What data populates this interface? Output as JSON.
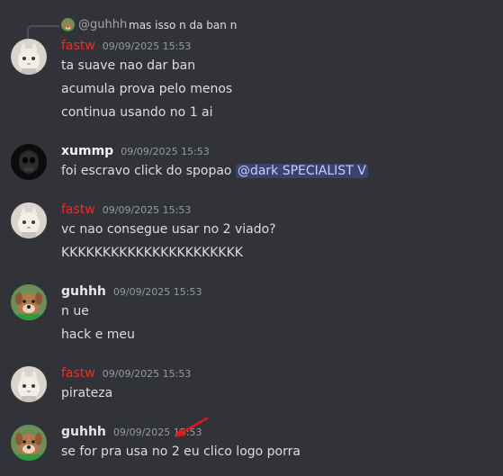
{
  "reply": {
    "user": "@guhhh",
    "text": "mas isso n da ban n"
  },
  "messages": [
    {
      "user": "fastw",
      "time": "09/09/2025 15:53",
      "lines": [
        "ta suave nao dar ban",
        "acumula prova pelo menos",
        "continua usando no 1 ai"
      ]
    },
    {
      "user": "xummp",
      "time": "09/09/2025 15:53",
      "text_before_mention": "foi escravo click do spopao ",
      "mention": "@dark SPECIALIST V"
    },
    {
      "user": "fastw",
      "time": "09/09/2025 15:53",
      "lines": [
        "vc nao consegue usar no 2 viado?",
        "KKKKKKKKKKKKKKKKKKKKKK"
      ]
    },
    {
      "user": "guhhh",
      "time": "09/09/2025 15:53",
      "lines": [
        "n ue",
        "hack e meu"
      ]
    },
    {
      "user": "fastw",
      "time": "09/09/2025 15:53",
      "lines": [
        "pirateza"
      ]
    },
    {
      "user": "guhhh",
      "time": "09/09/2025 15:53",
      "lines": [
        "se for pra usa no 2 eu clico logo porra"
      ]
    }
  ],
  "icons": {
    "fastw_avatar": "cat-avatar-icon",
    "xummp_avatar": "dark-skull-avatar-icon",
    "guhhh_avatar": "dog-avatar-icon",
    "annotation": "red-arrow-icon"
  },
  "colors": {
    "background": "#313338",
    "fastw_name": "#ed2b2b",
    "mention_bg": "#3c4270"
  }
}
